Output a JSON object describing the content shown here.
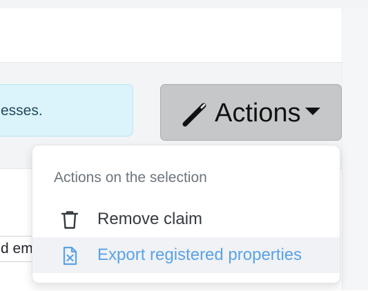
{
  "alert": {
    "text": "esses."
  },
  "field": {
    "value": "d em"
  },
  "actions_button": {
    "label": "Actions"
  },
  "dropdown": {
    "header": "Actions on the selection",
    "items": [
      {
        "label": "Remove claim",
        "icon": "trash-icon"
      },
      {
        "label": "Export registered properties",
        "icon": "file-excel-icon",
        "state": "hovered"
      }
    ]
  },
  "colors": {
    "button_bg": "#c6c7c9",
    "alert_bg": "#dbf3fa",
    "hover_item_text": "#5aa2e6",
    "hover_item_bg": "#f0f2f5"
  }
}
